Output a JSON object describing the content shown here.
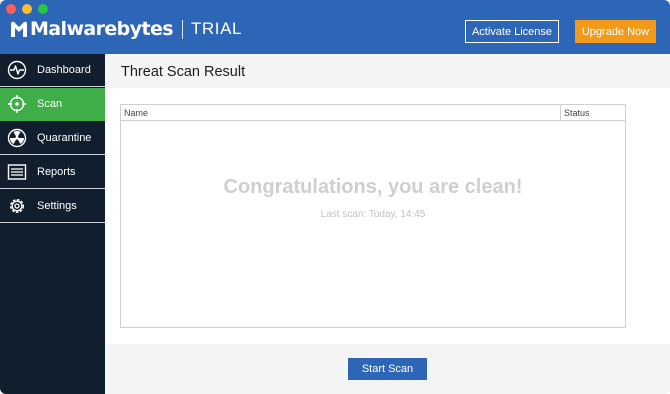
{
  "header": {
    "brand_name": "Malwarebytes",
    "brand_edition": "TRIAL",
    "activate_label": "Activate License",
    "upgrade_label": "Upgrade Now",
    "colors": {
      "header_bg": "#2e66b7",
      "upgrade_bg": "#f39a1b"
    }
  },
  "sidebar": {
    "items": [
      {
        "label": "Dashboard",
        "icon": "pulse-icon",
        "active": false
      },
      {
        "label": "Scan",
        "icon": "crosshair-icon",
        "active": true
      },
      {
        "label": "Quarantine",
        "icon": "radiation-icon",
        "active": false
      },
      {
        "label": "Reports",
        "icon": "list-icon",
        "active": false
      },
      {
        "label": "Settings",
        "icon": "gear-icon",
        "active": false
      }
    ],
    "colors": {
      "bg": "#101e2d",
      "active_bg": "#3fae49"
    }
  },
  "main": {
    "title": "Threat Scan Result",
    "table": {
      "columns": [
        "Name",
        "Status"
      ],
      "rows": []
    },
    "message": "Congratulations, you are clean!",
    "last_scan": "Last scan: Today, 14:45",
    "start_scan_label": "Start Scan"
  }
}
